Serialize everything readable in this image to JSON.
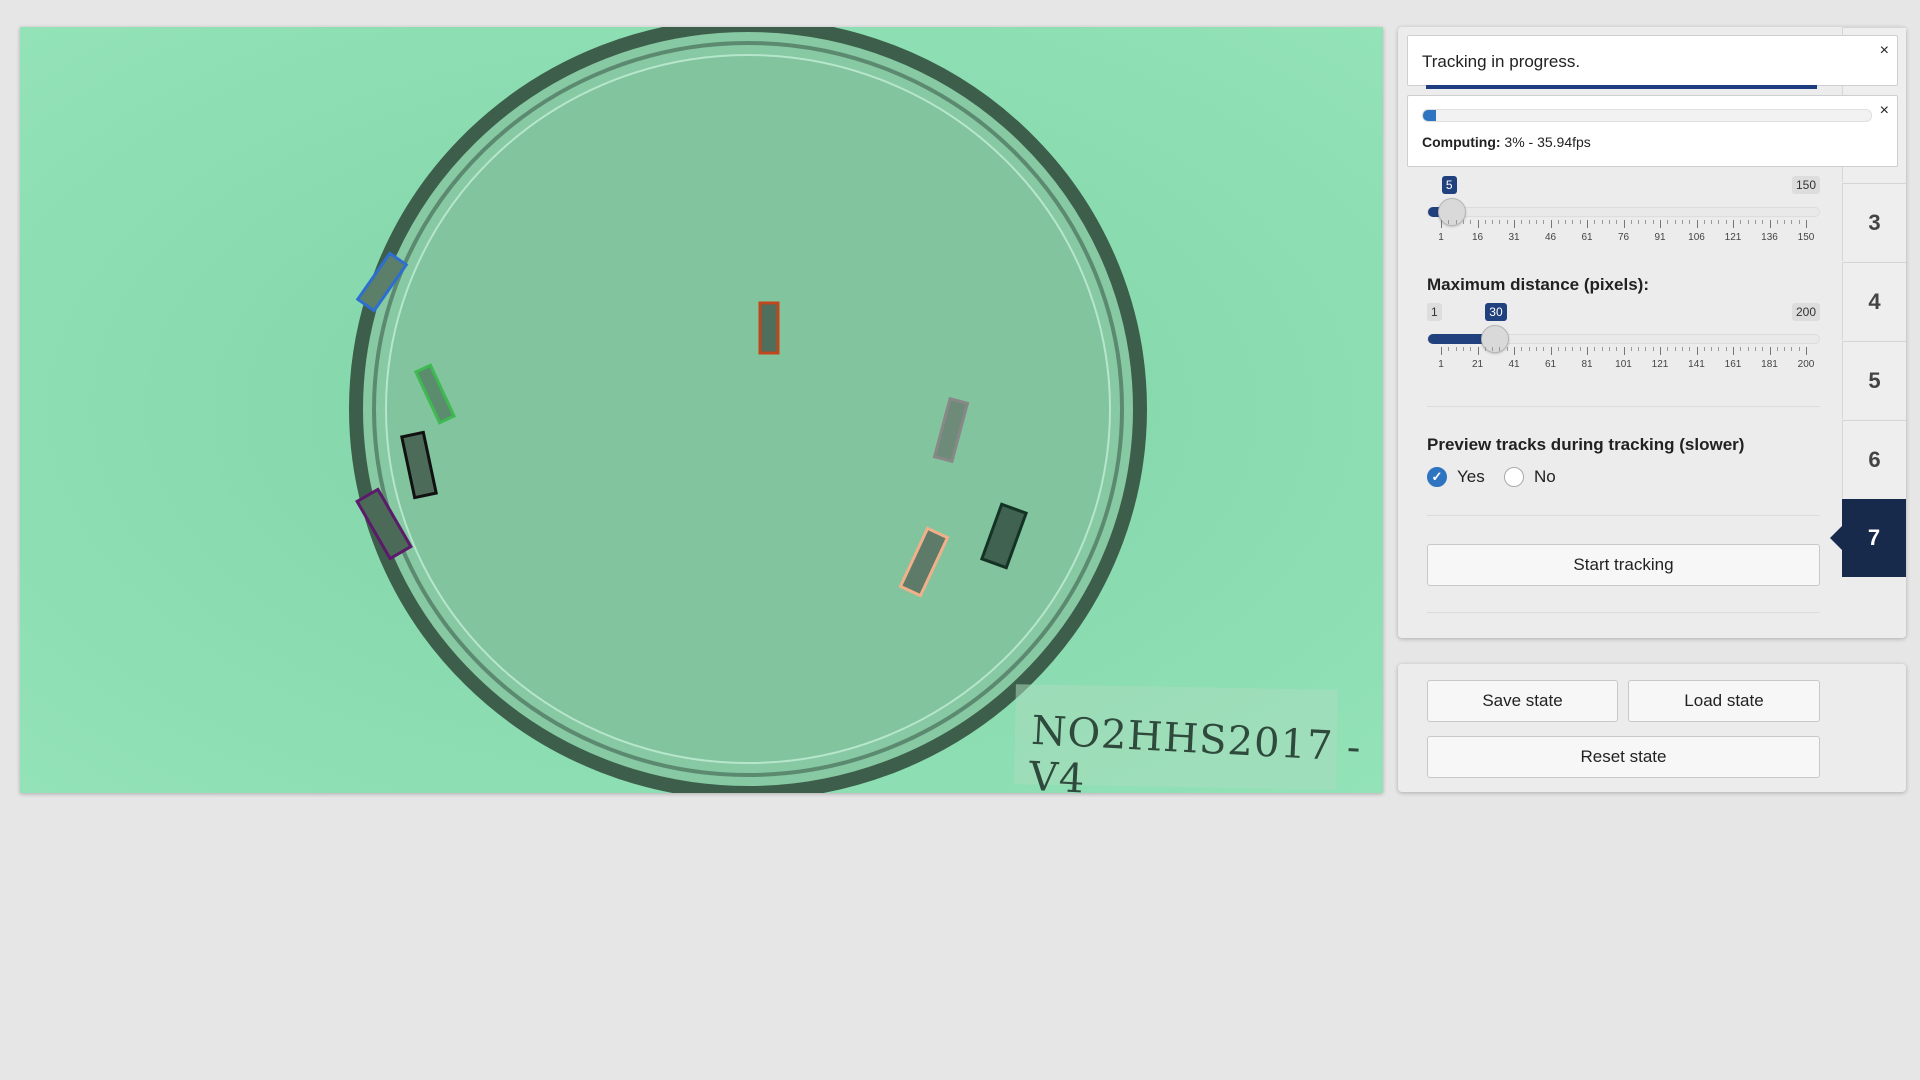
{
  "notifications": {
    "status_message": "Tracking in progress.",
    "close_glyph": "×",
    "progress": {
      "percent": 3,
      "label": "Computing:",
      "detail": "3% - 35.94fps"
    }
  },
  "tabs": [
    "3",
    "4",
    "5",
    "6",
    "7"
  ],
  "active_tab": "7",
  "slider_frames": {
    "min": "1",
    "max": "150",
    "value": "5",
    "fraction": 0.027,
    "ticks": [
      "1",
      "16",
      "31",
      "46",
      "61",
      "76",
      "91",
      "106",
      "121",
      "136",
      "150"
    ]
  },
  "slider_distance": {
    "label": "Maximum distance (pixels):",
    "min": "1",
    "max": "200",
    "value": "30",
    "fraction": 0.146,
    "ticks": [
      "1",
      "21",
      "41",
      "61",
      "81",
      "101",
      "121",
      "141",
      "161",
      "181",
      "200"
    ]
  },
  "preview": {
    "label": "Preview tracks during tracking (slower)",
    "options": [
      {
        "label": "Yes",
        "selected": true
      },
      {
        "label": "No",
        "selected": false
      }
    ]
  },
  "buttons": {
    "start": "Start tracking",
    "save": "Save state",
    "load": "Load state",
    "reset": "Reset state"
  },
  "video": {
    "label_text": "NO2HHS2017 - V4"
  },
  "colors": {
    "accent": "#21407e",
    "progress": "#2f74c0",
    "active_tab": "#172a4b",
    "video_bg": "#8ddcb0"
  }
}
